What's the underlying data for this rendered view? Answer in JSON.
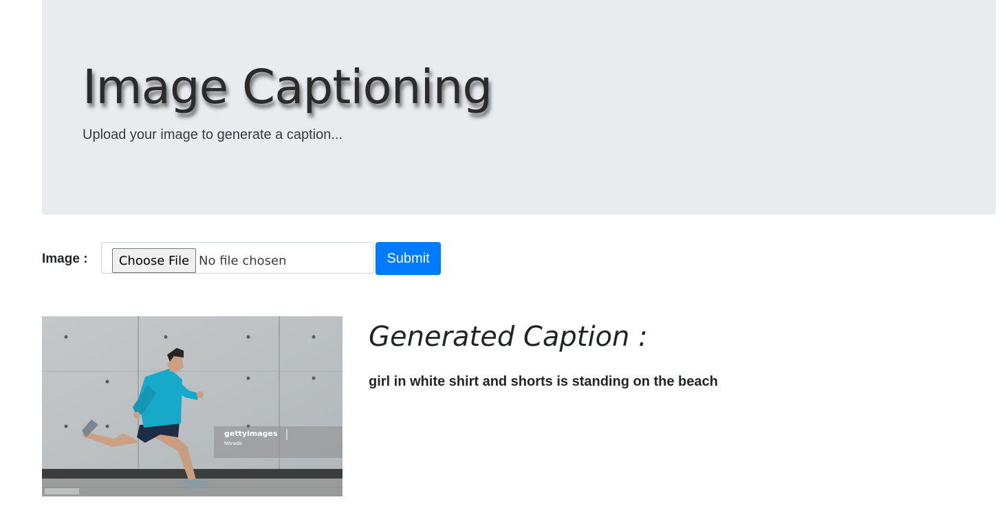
{
  "jumbotron": {
    "title": "Image Captioning",
    "lead": "Upload your image to generate a caption..."
  },
  "form": {
    "label": "Image :",
    "choose_file_label": "Choose File",
    "no_file_text": "No file chosen",
    "submit_label": "Submit"
  },
  "result": {
    "heading": "Generated Caption :",
    "caption": "girl in white shirt and shorts is standing on the beach",
    "image": {
      "watermark_brand": "gettyimages",
      "watermark_sub": "Nitrado"
    }
  },
  "colors": {
    "jumbotron_bg": "#e9ecef",
    "primary": "#007bff"
  }
}
